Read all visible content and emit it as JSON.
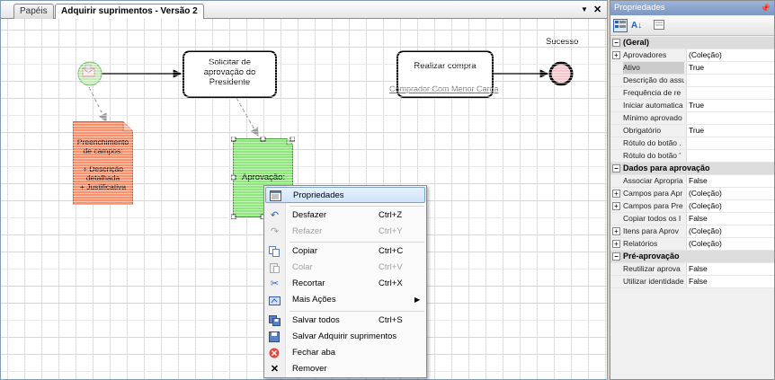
{
  "tabs": [
    {
      "label": "Papéis",
      "active": false
    },
    {
      "label": "Adquirir suprimentos - Versão 2",
      "active": true
    }
  ],
  "tab_controls": {
    "dropdown": "▼",
    "close": "✕"
  },
  "diagram": {
    "task_solicitar": "Solicitar de aprovação do Presidente",
    "task_realizar": "Realizar compra",
    "realizar_link": "Comprador Com Menor Carga",
    "doc_preenchimento": "Preenchimento de campos:\n\n+ Descrição detalhada\n+ Justificativa",
    "aprovacao_label": "Aprovação:",
    "end_event_label": "Sucesso"
  },
  "context_menu": {
    "items": [
      {
        "label": "Propriedades",
        "shortcut": "",
        "icon": "properties-icon",
        "disabled": false,
        "highlighted": true
      },
      {
        "label": "Desfazer",
        "shortcut": "Ctrl+Z",
        "icon": "undo-icon",
        "disabled": false
      },
      {
        "label": "Refazer",
        "shortcut": "Ctrl+Y",
        "icon": "redo-icon",
        "disabled": true
      },
      {
        "label": "Copiar",
        "shortcut": "Ctrl+C",
        "icon": "copy-icon",
        "disabled": false
      },
      {
        "label": "Colar",
        "shortcut": "Ctrl+V",
        "icon": "paste-icon",
        "disabled": true
      },
      {
        "label": "Recortar",
        "shortcut": "Ctrl+X",
        "icon": "cut-icon",
        "disabled": false
      },
      {
        "label": "Mais Ações",
        "shortcut": "",
        "icon": "more-actions-icon",
        "disabled": false,
        "submenu": true
      },
      {
        "label": "Salvar todos",
        "shortcut": "Ctrl+S",
        "icon": "save-all-icon",
        "disabled": false
      },
      {
        "label": "Salvar Adquirir suprimentos",
        "shortcut": "",
        "icon": "save-icon",
        "disabled": false
      },
      {
        "label": "Fechar aba",
        "shortcut": "",
        "icon": "close-tab-icon",
        "disabled": false
      },
      {
        "label": "Remover",
        "shortcut": "",
        "icon": "remove-icon",
        "disabled": false
      }
    ]
  },
  "properties": {
    "title": "Propriedades",
    "pin": "ᵩ",
    "categories": [
      {
        "label": "(Geral)",
        "rows": [
          {
            "name": "Aprovadores",
            "value": "(Coleção)",
            "expandable": true
          },
          {
            "name": "Ativo",
            "value": "True",
            "selected": true
          },
          {
            "name": "Descrição do assu",
            "value": ""
          },
          {
            "name": "Frequência de re",
            "value": ""
          },
          {
            "name": "Iniciar automatica",
            "value": "True"
          },
          {
            "name": "Mínimo aprovado",
            "value": ""
          },
          {
            "name": "Obrigatório",
            "value": "True"
          },
          {
            "name": "Rótulo do botão .",
            "value": ""
          },
          {
            "name": "Rótulo do botão '",
            "value": ""
          }
        ]
      },
      {
        "label": "Dados para aprovação",
        "rows": [
          {
            "name": "Associar Apropria",
            "value": "False"
          },
          {
            "name": "Campos para Apr",
            "value": "(Coleção)",
            "expandable": true
          },
          {
            "name": "Campos para Pre",
            "value": "(Coleção)",
            "expandable": true
          },
          {
            "name": "Copiar todos os I",
            "value": "False"
          },
          {
            "name": "Itens para Aprov",
            "value": "(Coleção)",
            "expandable": true
          },
          {
            "name": "Relatórios",
            "value": "(Coleção)",
            "expandable": true
          }
        ]
      },
      {
        "label": "Pré-aprovação",
        "rows": [
          {
            "name": "Reutilizar aprova",
            "value": "False"
          },
          {
            "name": "Utilizar identidade",
            "value": "False"
          }
        ]
      }
    ]
  }
}
